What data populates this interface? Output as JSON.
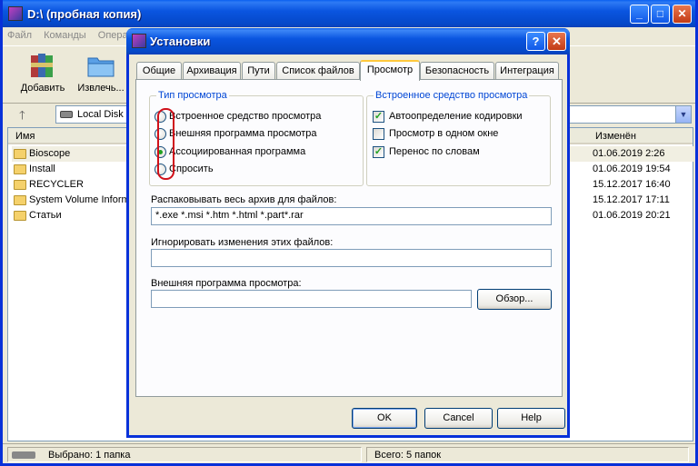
{
  "main_window": {
    "title": "D:\\ (пробная копия)",
    "menu": [
      "Файл",
      "Команды",
      "Опера"
    ],
    "toolbar": [
      {
        "label": "Добавить",
        "icon": "winrar-books-icon"
      },
      {
        "label": "Извлечь...",
        "icon": "extract-folder-icon"
      }
    ],
    "address": "Local Disk (D",
    "columns": {
      "name": "Имя",
      "modified": "Изменён"
    },
    "files": [
      {
        "name": "Bioscope",
        "modified": "01.06.2019 2:26"
      },
      {
        "name": "Install",
        "modified": "01.06.2019 19:54"
      },
      {
        "name": "RECYCLER",
        "modified": "15.12.2017 16:40"
      },
      {
        "name": "System Volume Informa",
        "modified": "15.12.2017 17:11"
      },
      {
        "name": "Статьи",
        "modified": "01.06.2019 20:21"
      }
    ],
    "status_left": "Выбрано: 1 папка",
    "status_right": "Всего: 5 папок"
  },
  "dialog": {
    "title": "Установки",
    "tabs": [
      "Общие",
      "Архивация",
      "Пути",
      "Список файлов",
      "Просмотр",
      "Безопасность",
      "Интеграция"
    ],
    "active_tab": "Просмотр",
    "view_type": {
      "title": "Тип просмотра",
      "options": [
        "Встроенное средство просмотра",
        "Внешняя программа просмотра",
        "Ассоциированная программа",
        "Спросить"
      ],
      "selected": "Ассоциированная программа"
    },
    "builtin_viewer": {
      "title": "Встроенное средство просмотра",
      "options": [
        {
          "label": "Автоопределение кодировки",
          "checked": true
        },
        {
          "label": "Просмотр в одном окне",
          "checked": false
        },
        {
          "label": "Перенос по словам",
          "checked": true
        }
      ]
    },
    "unpack_label": "Распаковывать весь архив для файлов:",
    "unpack_value": "*.exe *.msi *.htm *.html *.part*.rar",
    "ignore_label": "Игнорировать изменения этих файлов:",
    "ignore_value": "",
    "external_label": "Внешняя программа просмотра:",
    "external_value": "",
    "browse_label": "Обзор...",
    "ok_label": "OK",
    "cancel_label": "Cancel",
    "help_label": "Help"
  }
}
